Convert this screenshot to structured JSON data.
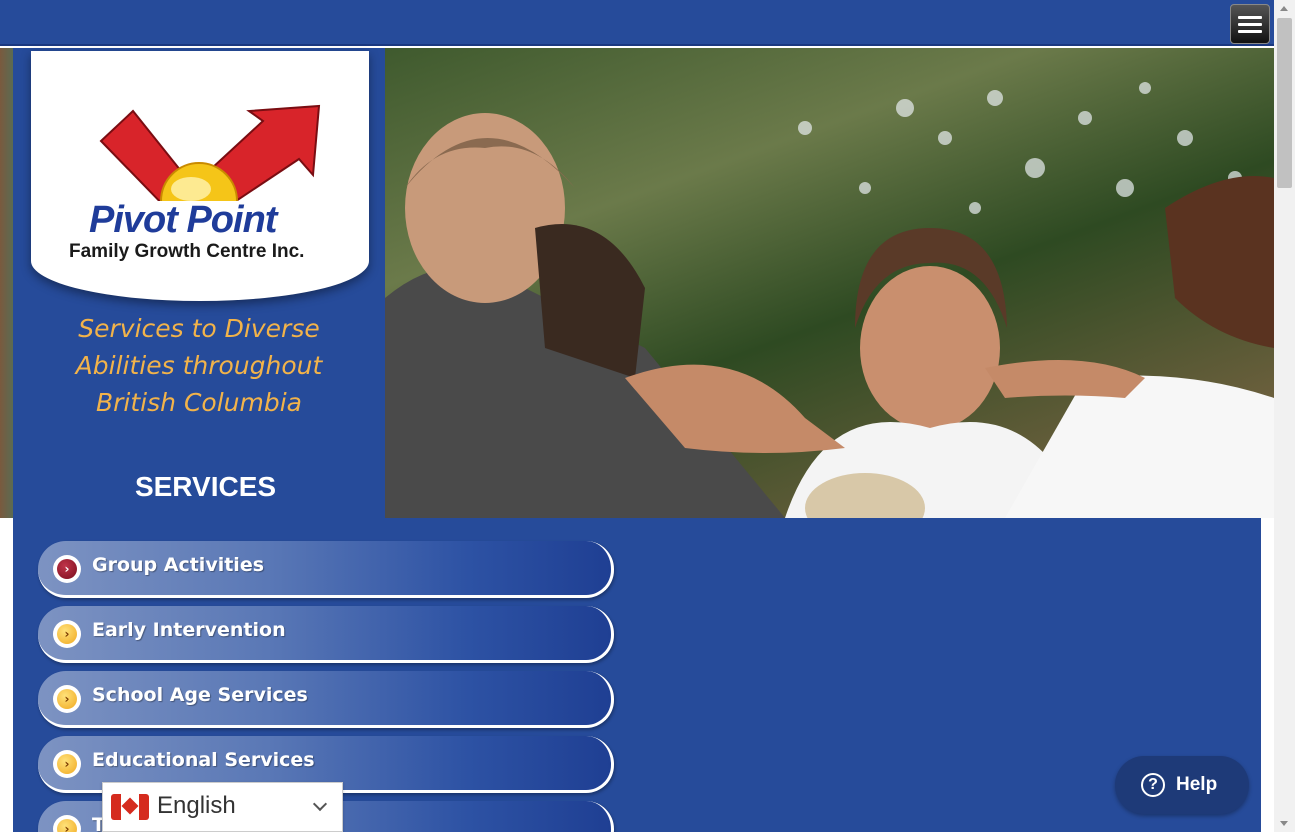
{
  "header": {
    "menu_icon": "hamburger-menu-icon"
  },
  "brand": {
    "name": "Pivot Point",
    "subtitle": "Family Growth Centre Inc.",
    "logo_colors": {
      "arrow": "#d8242a",
      "sun": "#f5c518",
      "text": "#1f3c9a"
    }
  },
  "tagline": {
    "line1": "Services to Diverse",
    "line2": "Abilities throughout",
    "line3": "British Columbia"
  },
  "services": {
    "heading": "SERVICES",
    "items": [
      {
        "label": "Group Activities",
        "active": true
      },
      {
        "label": "Early Intervention",
        "active": false
      },
      {
        "label": "School Age Services",
        "active": false
      },
      {
        "label": "Educational Services",
        "active": false
      },
      {
        "label": "T",
        "active": false
      }
    ]
  },
  "language": {
    "label": "English",
    "flag": "canada-flag-icon"
  },
  "help": {
    "label": "Help",
    "icon": "question-circle-icon"
  },
  "colors": {
    "primary": "#264b9a",
    "accent": "#f2b34a",
    "help": "#1e3a78"
  }
}
